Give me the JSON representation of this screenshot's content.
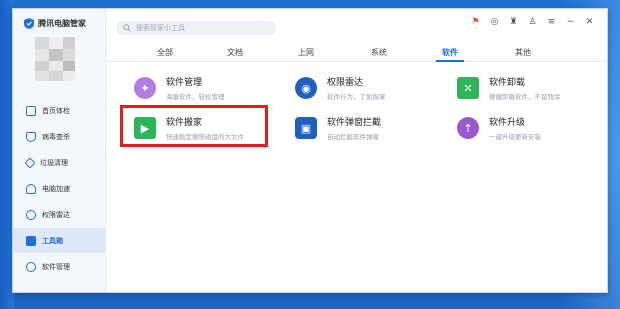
{
  "app": {
    "title": "腾讯电脑管家"
  },
  "search": {
    "placeholder": "搜索管家小工具"
  },
  "sidebar": {
    "items": [
      {
        "label": "首页体检",
        "icon": "monitor-icon",
        "color": "#1f6fe0"
      },
      {
        "label": "病毒查杀",
        "icon": "shield-icon",
        "color": "#1f6fe0"
      },
      {
        "label": "垃圾清理",
        "icon": "broom-icon",
        "color": "#1f6fe0"
      },
      {
        "label": "电脑加速",
        "icon": "rocket-icon",
        "color": "#1f6fe0"
      },
      {
        "label": "权限雷达",
        "icon": "radar-icon",
        "color": "#1f6fe0"
      },
      {
        "label": "工具箱",
        "icon": "toolbox-icon",
        "color": "#1f6fe0",
        "active": true
      },
      {
        "label": "软件管理",
        "icon": "apps-icon",
        "color": "#1f6fe0"
      }
    ]
  },
  "tabs": [
    {
      "label": "全部"
    },
    {
      "label": "文档"
    },
    {
      "label": "上网"
    },
    {
      "label": "系统"
    },
    {
      "label": "软件",
      "active": true
    },
    {
      "label": "其他"
    }
  ],
  "tools": [
    {
      "name": "软件管理",
      "desc": "海量软件，轻松管理",
      "icon": "butterfly-icon",
      "color": "#9b59d0"
    },
    {
      "name": "权限雷达",
      "desc": "软件行为，了如指掌",
      "icon": "radar-icon",
      "color": "#1f5fc0"
    },
    {
      "name": "软件卸载",
      "desc": "便捷卸载软件，不留残余",
      "icon": "trash-icon",
      "color": "#2eb55a"
    },
    {
      "name": "软件搬家",
      "desc": "快速稳定搬移磁盘的大文件",
      "icon": "truck-icon",
      "color": "#2eb55a"
    },
    {
      "name": "软件弹窗拦截",
      "desc": "自动拦截软件弹窗",
      "icon": "popup-block-icon",
      "color": "#1f5fc0"
    },
    {
      "name": "软件升级",
      "desc": "一键升级更新安装",
      "icon": "upgrade-icon",
      "color": "#9b59d0"
    }
  ]
}
